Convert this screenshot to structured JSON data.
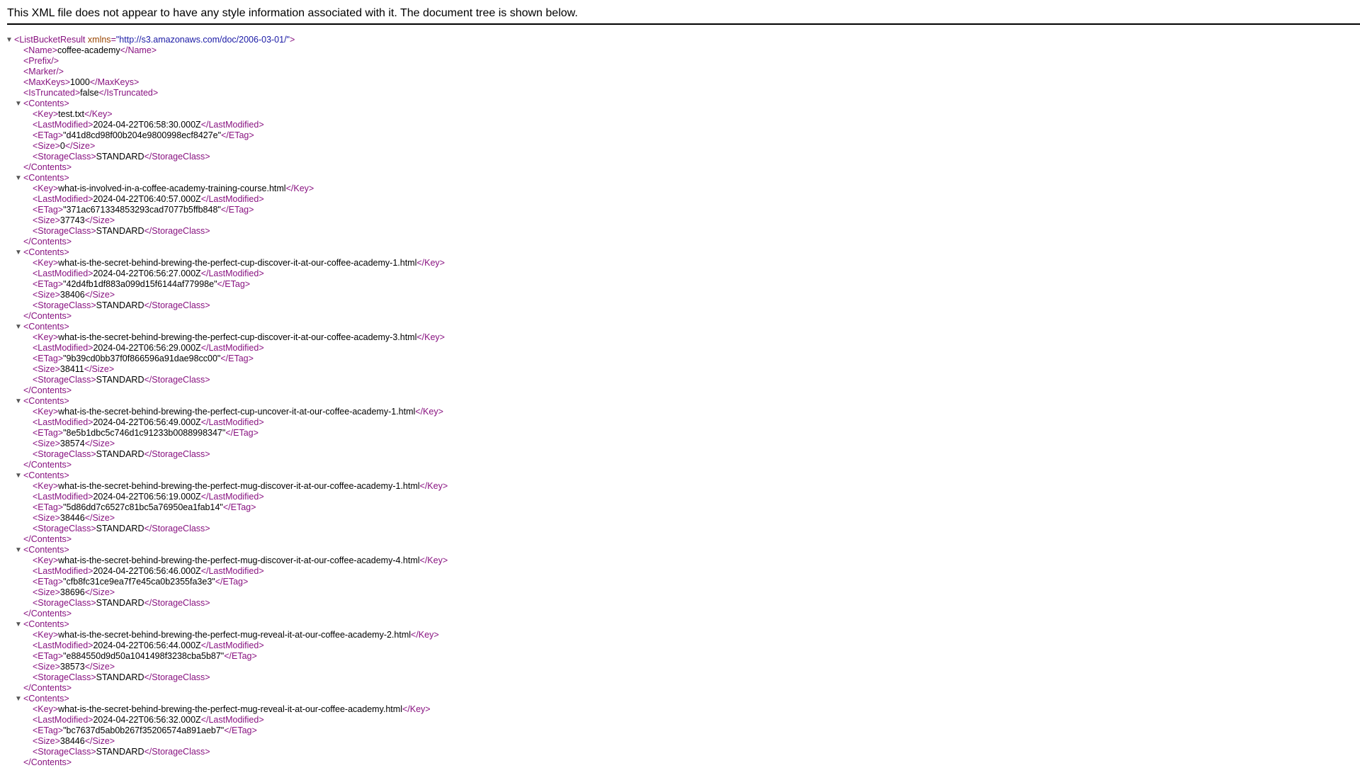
{
  "header": {
    "message": "This XML file does not appear to have any style information associated with it. The document tree is shown below."
  },
  "root": {
    "tag": "ListBucketResult",
    "attr_name": "xmlns",
    "attr_value": "\"http://s3.amazonaws.com/doc/2006-03-01/\""
  },
  "bucket": {
    "name": "coffee-academy",
    "max_keys": "1000",
    "is_truncated": "false"
  },
  "contents": [
    {
      "key": "test.txt",
      "last_modified": "2024-04-22T06:58:30.000Z",
      "etag": "\"d41d8cd98f00b204e9800998ecf8427e\"",
      "size": "0",
      "storage_class": "STANDARD"
    },
    {
      "key": "what-is-involved-in-a-coffee-academy-training-course.html",
      "last_modified": "2024-04-22T06:40:57.000Z",
      "etag": "\"371ac671334853293cad7077b5ffb848\"",
      "size": "37743",
      "storage_class": "STANDARD"
    },
    {
      "key": "what-is-the-secret-behind-brewing-the-perfect-cup-discover-it-at-our-coffee-academy-1.html",
      "last_modified": "2024-04-22T06:56:27.000Z",
      "etag": "\"42d4fb1df883a099d15f6144af77998e\"",
      "size": "38406",
      "storage_class": "STANDARD"
    },
    {
      "key": "what-is-the-secret-behind-brewing-the-perfect-cup-discover-it-at-our-coffee-academy-3.html",
      "last_modified": "2024-04-22T06:56:29.000Z",
      "etag": "\"9b39cd0bb37f0f866596a91dae98cc00\"",
      "size": "38411",
      "storage_class": "STANDARD"
    },
    {
      "key": "what-is-the-secret-behind-brewing-the-perfect-cup-uncover-it-at-our-coffee-academy-1.html",
      "last_modified": "2024-04-22T06:56:49.000Z",
      "etag": "\"8e5b1dbc5c746d1c91233b0088998347\"",
      "size": "38574",
      "storage_class": "STANDARD"
    },
    {
      "key": "what-is-the-secret-behind-brewing-the-perfect-mug-discover-it-at-our-coffee-academy-1.html",
      "last_modified": "2024-04-22T06:56:19.000Z",
      "etag": "\"5d86dd7c6527c81bc5a76950ea1fab14\"",
      "size": "38446",
      "storage_class": "STANDARD"
    },
    {
      "key": "what-is-the-secret-behind-brewing-the-perfect-mug-discover-it-at-our-coffee-academy-4.html",
      "last_modified": "2024-04-22T06:56:46.000Z",
      "etag": "\"cfb8fc31ce9ea7f7e45ca0b2355fa3e3\"",
      "size": "38696",
      "storage_class": "STANDARD"
    },
    {
      "key": "what-is-the-secret-behind-brewing-the-perfect-mug-reveal-it-at-our-coffee-academy-2.html",
      "last_modified": "2024-04-22T06:56:44.000Z",
      "etag": "\"e884550d9d50a1041498f3238cba5b87\"",
      "size": "38573",
      "storage_class": "STANDARD"
    },
    {
      "key": "what-is-the-secret-behind-brewing-the-perfect-mug-reveal-it-at-our-coffee-academy.html",
      "last_modified": "2024-04-22T06:56:32.000Z",
      "etag": "\"bc7637d5ab0b267f35206574a891aeb7\"",
      "size": "38446",
      "storage_class": "STANDARD"
    }
  ],
  "icons": {
    "expanded_toggle": "triangle-down-icon"
  },
  "colors": {
    "tag": "#881280",
    "attribute_name": "#994500",
    "attribute_value": "#1a1aa6",
    "text": "#000000"
  }
}
